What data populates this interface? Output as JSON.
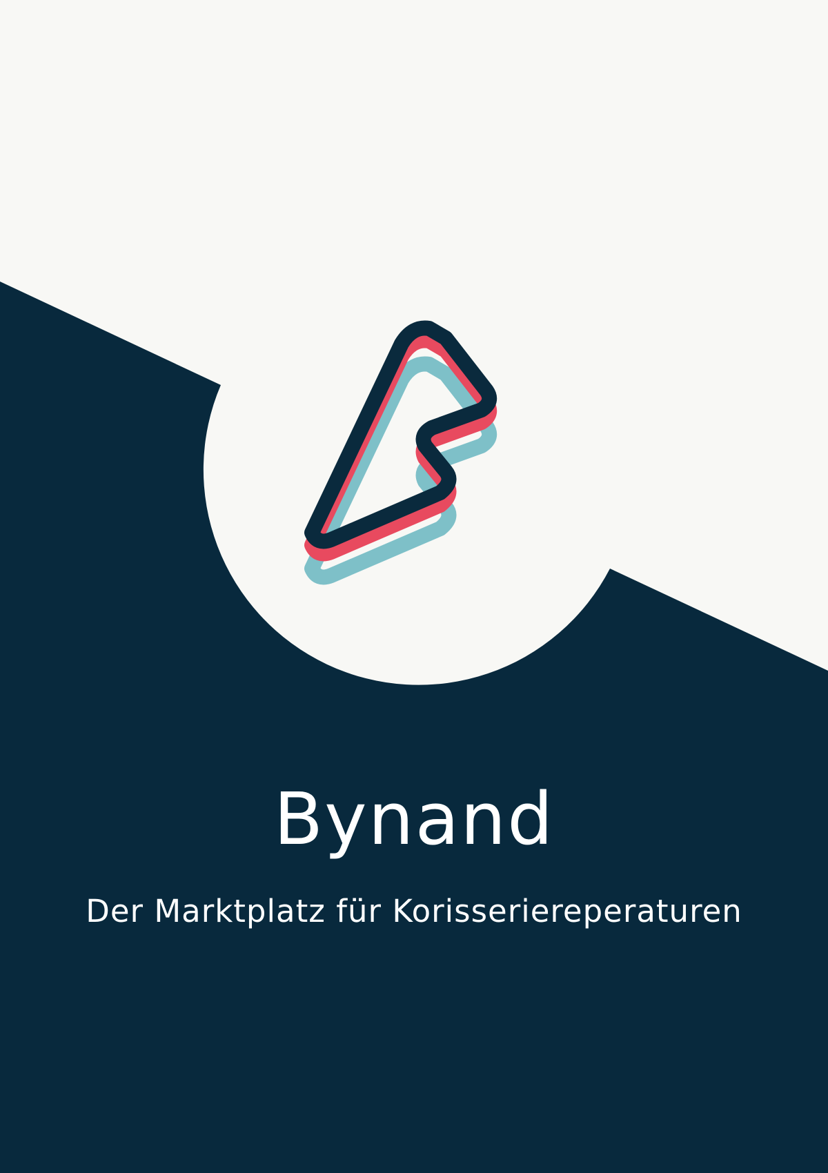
{
  "brand": {
    "name": "Bynand",
    "tagline": "Der Marktplatz für Korisseriereperaturen"
  },
  "colors": {
    "background_light": "#F8F8F5",
    "background_dark": "#08293D",
    "logo_outline": "#0A2A3D",
    "logo_red": "#E84A5F",
    "logo_teal": "#7EC0C8",
    "text": "#FFFFFF"
  },
  "logo": {
    "icon": "bolt-logo-icon"
  }
}
